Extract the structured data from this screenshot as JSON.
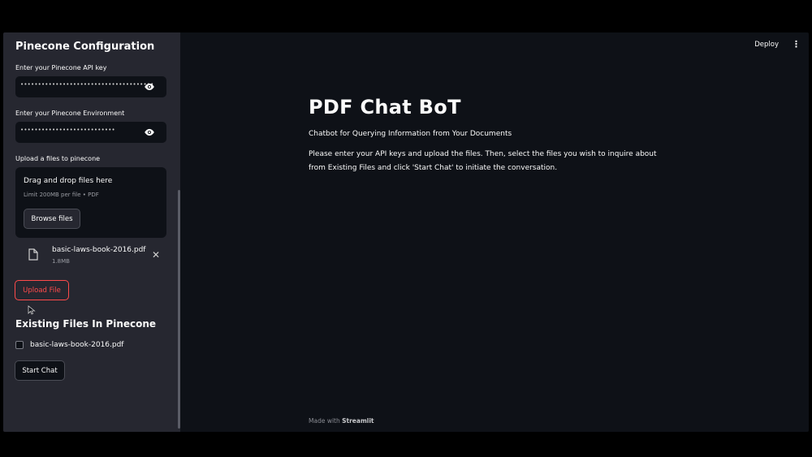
{
  "sidebar": {
    "title": "Pinecone Configuration",
    "api_key": {
      "label": "Enter your Pinecone API key",
      "masked_value": "••••••••••••••••••••••••••••••••••••••"
    },
    "environment": {
      "label": "Enter your Pinecone Environment",
      "masked_value": "•••••••••••••••••••••••••••"
    },
    "upload": {
      "label": "Upload a files to pinecone",
      "drop_title": "Drag and drop files here",
      "drop_subtitle": "Limit 200MB per file • PDF",
      "browse_label": "Browse files",
      "file": {
        "name": "basic-laws-book-2016.pdf",
        "size": "1.8MB"
      },
      "upload_label": "Upload File"
    },
    "existing": {
      "heading": "Existing Files In Pinecone",
      "files": [
        {
          "name": "basic-laws-book-2016.pdf",
          "checked": false
        }
      ],
      "start_label": "Start Chat"
    }
  },
  "header": {
    "deploy_label": "Deploy",
    "menu_icon": "⋮"
  },
  "main": {
    "title": "PDF Chat BoT",
    "subtitle": "Chatbot for Querying Information from Your Documents",
    "description": "Please enter your API keys and upload the files. Then, select the files you wish to inquire about from Existing Files and click 'Start Chat' to initiate the conversation."
  },
  "footer": {
    "prefix": "Made with",
    "brand": "Streamlit"
  },
  "colors": {
    "accent": "#ff4b4b",
    "sidebar_bg": "#262730",
    "main_bg": "#0e1117"
  }
}
